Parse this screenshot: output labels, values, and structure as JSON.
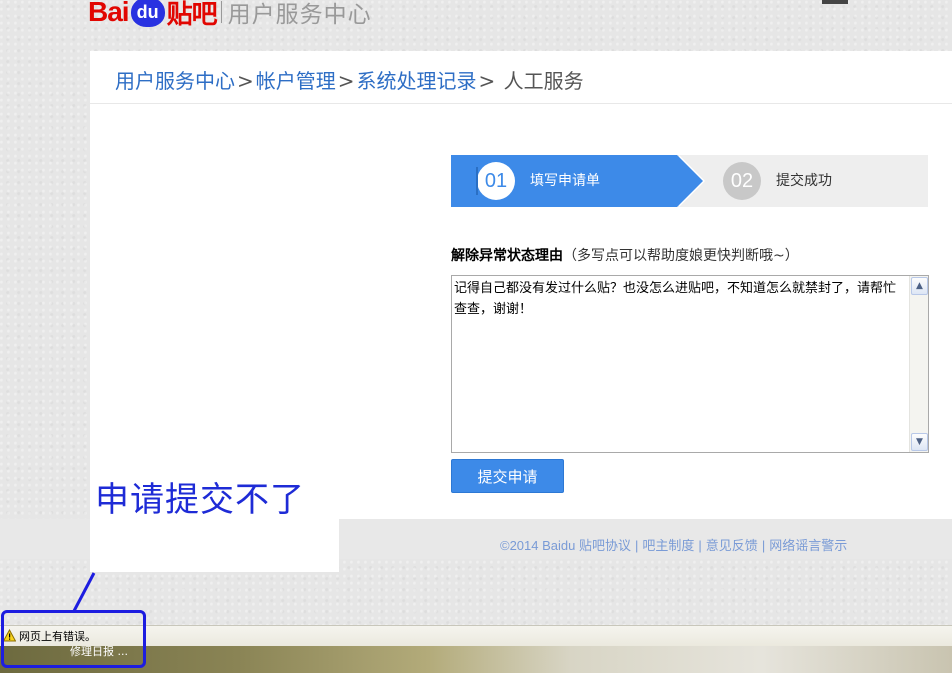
{
  "header": {
    "logo_bai": "Bai",
    "logo_du": "du",
    "logo_tieba": "贴吧",
    "subtitle": "用户服务中心"
  },
  "breadcrumb": {
    "items": [
      "用户服务中心",
      "帐户管理",
      "系统处理记录"
    ],
    "separator": ">",
    "current": "人工服务"
  },
  "steps": [
    {
      "number": "01",
      "label": "填写申请单",
      "active": true
    },
    {
      "number": "02",
      "label": "提交成功",
      "active": false
    }
  ],
  "form": {
    "reason_label": "解除异常状态理由",
    "reason_hint": "（多写点可以帮助度娘更快判断哦~）",
    "reason_value": "记得自己都没有发过什么贴？也没怎么进贴吧，不知道怎么就禁封了，请帮忙查查，谢谢！",
    "submit_label": "提交申请"
  },
  "footer": {
    "copyright": "©2014 Baidu",
    "links": [
      "贴吧协议",
      "吧主制度",
      "意见反馈",
      "网络谣言警示"
    ],
    "separator": "|"
  },
  "annotation": {
    "text": "申请提交不了"
  },
  "statusbar": {
    "text": "网页上有错误。",
    "icon": "warning-icon"
  },
  "taskbar": {
    "item_text": "修理日报 ..."
  },
  "colors": {
    "accent": "#3d8ae8",
    "link": "#2e6ec5",
    "brand_red": "#e10601",
    "annotation_blue": "#1e2bd6"
  }
}
